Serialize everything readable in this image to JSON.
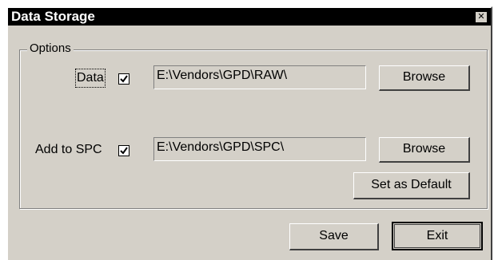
{
  "window": {
    "title": "Data Storage",
    "close_icon": "close-icon"
  },
  "options": {
    "group_label": "Options",
    "data": {
      "label": "Data",
      "checked": true,
      "path": "E:\\Vendors\\GPD\\RAW\\",
      "browse_label": "Browse"
    },
    "spc": {
      "label": "Add to SPC",
      "checked": true,
      "path": "E:\\Vendors\\GPD\\SPC\\",
      "browse_label": "Browse"
    },
    "set_default_label": "Set as Default"
  },
  "footer": {
    "save_label": "Save",
    "exit_label": "Exit"
  },
  "colors": {
    "face": "#d4d0c8",
    "titlebar": "#000000"
  }
}
